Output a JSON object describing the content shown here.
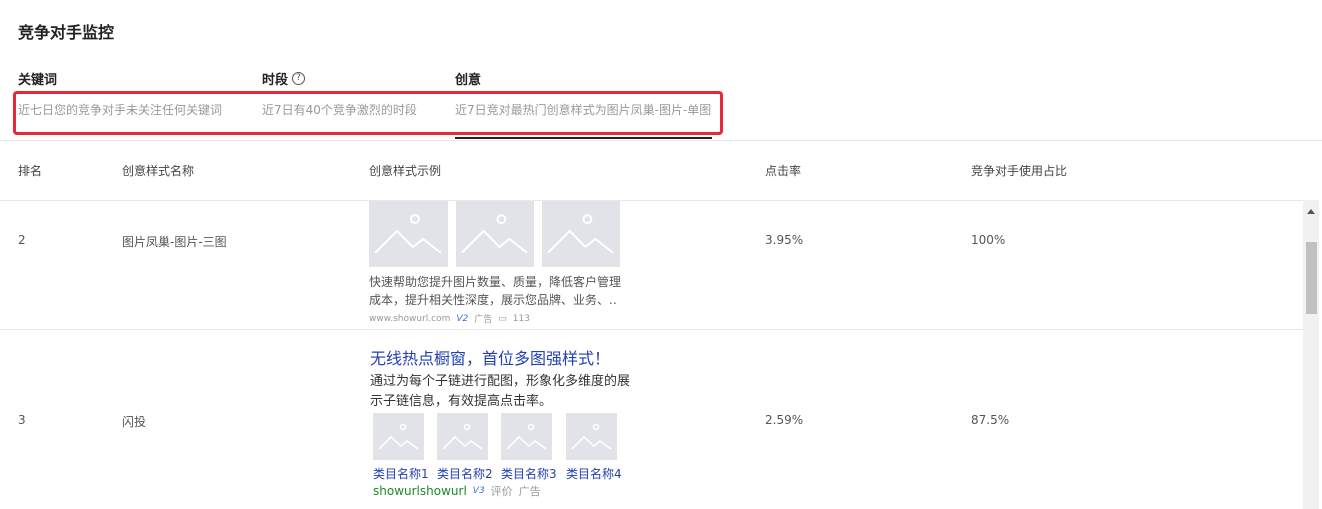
{
  "page_title": "竞争对手监控",
  "summary": [
    {
      "heading": "关键词",
      "text": "近七日您的竞争对手未关注任何关键词"
    },
    {
      "heading": "时段",
      "text": "近7日有40个竞争激烈的时段"
    },
    {
      "heading": "创意",
      "text": "近7日竞对最热门创意样式为图片凤巢-图片-单图"
    }
  ],
  "help_glyph": "?",
  "table": {
    "headers": [
      "排名",
      "创意样式名称",
      "创意样式示例",
      "点击率",
      "竞争对手使用占比"
    ],
    "rows": [
      {
        "rank": "2",
        "name": "图片凤巢-图片-三图",
        "ctr": "3.95%",
        "share": "100%"
      },
      {
        "rank": "3",
        "name": "闪投",
        "ctr": "2.59%",
        "share": "87.5%"
      }
    ]
  },
  "creative1": {
    "desc": "快速帮助您提升图片数量、质量，降低客户管理成本，提升相关性深度，展示您品牌、业务、..",
    "url": "www.showurl.com",
    "v_badge": "V2",
    "ad_label": "广告",
    "comment_count": "113"
  },
  "creative2": {
    "title": "无线热点橱窗，首位多图强样式！",
    "desc": "通过为每个子链进行配图，形象化多维度的展示子链信息，有效提高点击率。",
    "categories": [
      "类目名称1",
      "类目名称2",
      "类目名称3",
      "类目名称4"
    ],
    "url": "showurlshowurl",
    "v_badge": "V3",
    "review_label": "评价",
    "ad_label": "广告"
  },
  "colors": {
    "highlight": "#e8273a",
    "link": "#2440b3",
    "url_green": "#1a8a2a"
  }
}
